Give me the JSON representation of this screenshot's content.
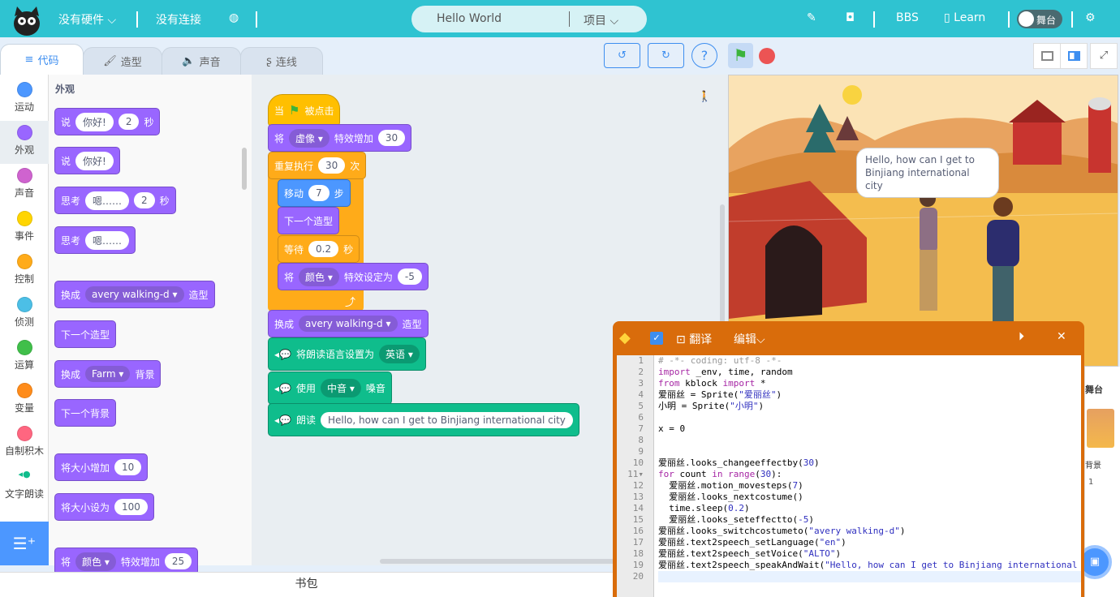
{
  "topbar": {
    "hardware": "没有硬件",
    "connection": "没有连接",
    "project_name": "Hello World",
    "project_menu": "项目",
    "bbs": "BBS",
    "learn": "Learn",
    "stage_toggle": "舞台"
  },
  "tabs": [
    {
      "label": "代码"
    },
    {
      "label": "造型"
    },
    {
      "label": "声音"
    },
    {
      "label": "连线"
    }
  ],
  "toolbar": {
    "help": "?"
  },
  "categories": [
    {
      "label": "运动",
      "color": "#4c97ff"
    },
    {
      "label": "外观",
      "color": "#9966ff"
    },
    {
      "label": "声音",
      "color": "#cf63cf"
    },
    {
      "label": "事件",
      "color": "#ffd500"
    },
    {
      "label": "控制",
      "color": "#ffab19"
    },
    {
      "label": "侦测",
      "color": "#4cbfe6"
    },
    {
      "label": "运算",
      "color": "#40bf4a"
    },
    {
      "label": "变量",
      "color": "#ff8c1a"
    },
    {
      "label": "自制积木",
      "color": "#ff6680"
    },
    {
      "label": "文字朗读"
    }
  ],
  "palette": {
    "heading": "外观",
    "blocks": [
      {
        "parts": [
          "说",
          "你好!",
          "2",
          "秒"
        ]
      },
      {
        "parts": [
          "说",
          "你好!"
        ]
      },
      {
        "parts": [
          "思考",
          "嗯……",
          "2",
          "秒"
        ]
      },
      {
        "parts": [
          "思考",
          "嗯……"
        ]
      },
      {
        "parts": [
          "换成",
          "avery walking-d",
          "造型"
        ]
      },
      {
        "parts": [
          "下一个造型"
        ]
      },
      {
        "parts": [
          "换成",
          "Farm",
          "背景"
        ]
      },
      {
        "parts": [
          "下一个背景"
        ]
      },
      {
        "parts": [
          "将大小增加",
          "10"
        ]
      },
      {
        "parts": [
          "将大小设为",
          "100"
        ]
      },
      {
        "parts": [
          "将",
          "颜色",
          "特效增加",
          "25"
        ]
      }
    ]
  },
  "script": {
    "hat": [
      "当",
      "被点击"
    ],
    "effect_change": [
      "将",
      "虚像",
      "特效增加",
      "30"
    ],
    "repeat": [
      "重复执行",
      "30",
      "次"
    ],
    "move": [
      "移动",
      "7",
      "步"
    ],
    "next_costume": "下一个造型",
    "wait": [
      "等待",
      "0.2",
      "秒"
    ],
    "effect_set": [
      "将",
      "颜色",
      "特效设定为",
      "-5"
    ],
    "switch_costume": [
      "换成",
      "avery walking-d",
      "造型"
    ],
    "set_language": [
      "将朗读语言设置为",
      "英语"
    ],
    "set_voice": [
      "使用",
      "中音",
      "嗓音"
    ],
    "speak": [
      "朗读",
      "Hello, how can I get to Binjiang international city"
    ]
  },
  "stage": {
    "speech_bubble": "Hello, how can I get to Binjiang international city"
  },
  "sprite_panel": {
    "stage_label": "舞台",
    "backdrop_label": "背景",
    "backdrop_count": "1"
  },
  "python": {
    "translate": "翻译",
    "edit": "编辑",
    "checked": true,
    "lines": [
      "# -*- coding: utf-8 -*-",
      "import _env, time, random",
      "from kblock import *",
      "爱丽丝 = Sprite(\"爱丽丝\")",
      "小明 = Sprite(\"小明\")",
      "",
      "x = 0",
      "",
      "",
      "爱丽丝.looks_changeeffectby(30)",
      "for count in range(30):",
      "  爱丽丝.motion_movesteps(7)",
      "  爱丽丝.looks_nextcostume()",
      "  time.sleep(0.2)",
      "  爱丽丝.looks_seteffectto(-5)",
      "爱丽丝.looks_switchcostumeto(\"avery walking-d\")",
      "爱丽丝.text2speech_setLanguage(\"en\")",
      "爱丽丝.text2speech_setVoice(\"ALTO\")",
      "爱丽丝.text2speech_speakAndWait(\"Hello, how can I get to Binjiang international",
      ""
    ]
  },
  "backpack": "书包"
}
